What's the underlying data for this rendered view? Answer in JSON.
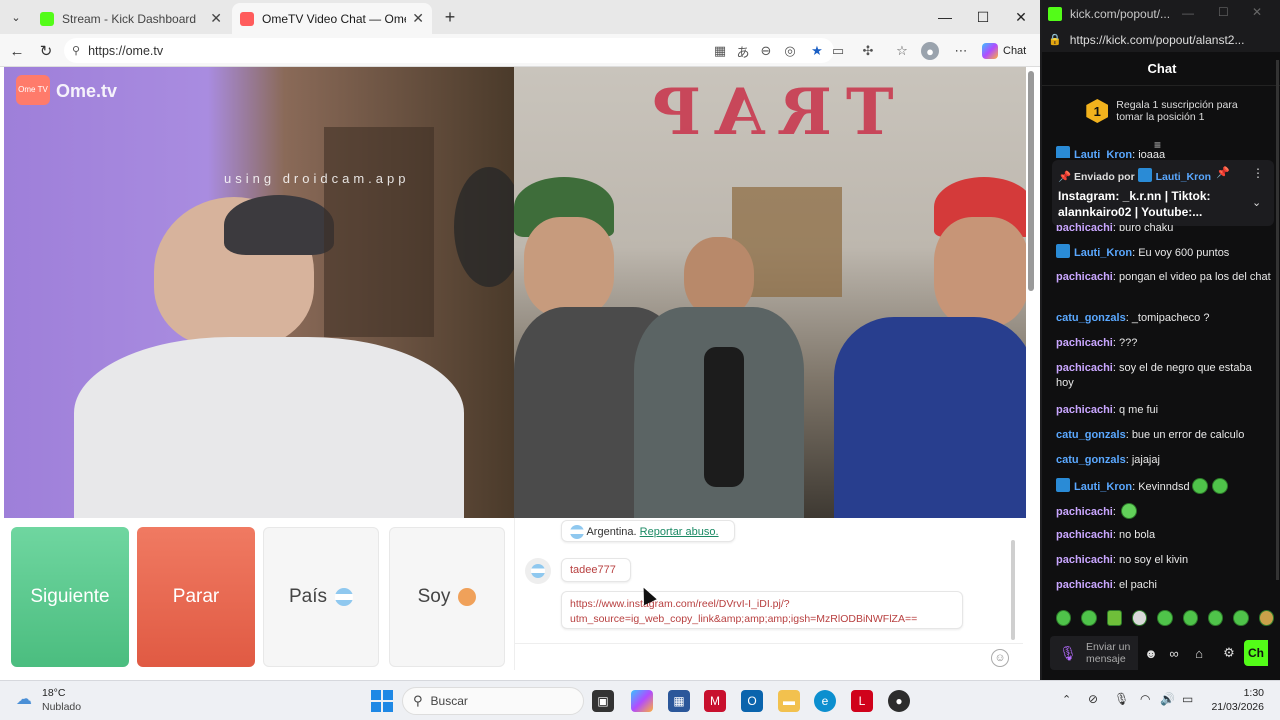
{
  "browser": {
    "tabs": [
      {
        "label": "Stream - Kick Dashboard",
        "active": false,
        "favicon_color": "#53fc18"
      },
      {
        "label": "OmeTV Video Chat — Omegl",
        "active": true,
        "favicon_color": "#ff5c5c"
      }
    ],
    "url": "https://ome.tv",
    "copilot_label": "Chat"
  },
  "ometv": {
    "logo_badge": "Ome TV",
    "logo_text": "Ome.tv",
    "watermark": "using droidcam.app",
    "wall_text": "TRAP",
    "buttons": {
      "next": "Siguiente",
      "stop": "Parar",
      "country": "País",
      "gender": "Soy"
    },
    "chat": {
      "system_country": "Argentina.",
      "report_link": "Reportar abuso.",
      "username": "tadee777",
      "link_line1": "https://www.instagram.com/reel/DVrvI-I_iDI.pj/?",
      "link_line2": "utm_source=ig_web_copy_link&amp;amp;amp;igsh=MzRlODBiNWFlZA=="
    }
  },
  "kick": {
    "window_title": "kick.com/popout/...",
    "url": "https://kick.com/popout/alanst2...",
    "chat_header": "Chat",
    "gift_badge": "1",
    "gift_text_1": "Regala 1 suscripción para",
    "gift_text_2": "tomar la posición 1",
    "partial_top": {
      "user": "Lauti_Kron",
      "text": "joaaa"
    },
    "pinned": {
      "sent_by_label": "Enviado por",
      "user": "Lauti_Kron",
      "text": "Instagram: _k.r.nn | Tiktok: alannkairo02 | Youtube:..."
    },
    "partial_under_pinned": {
      "user": "pachicachi",
      "text": "puro chaku"
    },
    "messages": [
      {
        "user": "Lauti_Kron",
        "text": "Eu voy 600 puntos",
        "color": "#5aa8ff",
        "badge": true
      },
      {
        "user": "pachicachi",
        "text": "pongan el video pa los del chat",
        "color": "#c9a6ff",
        "badge": false
      },
      {
        "user": "catu_gonzals",
        "text": "_tomipacheco ?",
        "color": "#5aa8ff",
        "badge": false
      },
      {
        "user": "pachicachi",
        "text": "???",
        "color": "#c9a6ff",
        "badge": false
      },
      {
        "user": "pachicachi",
        "text": "soy el de negro que estaba hoy",
        "color": "#c9a6ff",
        "badge": false
      },
      {
        "user": "pachicachi",
        "text": "q me fui",
        "color": "#c9a6ff",
        "badge": false
      },
      {
        "user": "catu_gonzals",
        "text": "bue un error de calculo",
        "color": "#5aa8ff",
        "badge": false
      },
      {
        "user": "catu_gonzals",
        "text": "jajajaj",
        "color": "#5aa8ff",
        "badge": false
      },
      {
        "user": "Lauti_Kron",
        "text": "Kevinndsd",
        "color": "#5aa8ff",
        "badge": true
      },
      {
        "user": "pachicachi",
        "text": "",
        "color": "#c9a6ff",
        "badge": false
      },
      {
        "user": "pachicachi",
        "text": "no bola",
        "color": "#c9a6ff",
        "badge": false
      },
      {
        "user": "pachicachi",
        "text": "no soy el kivin",
        "color": "#c9a6ff",
        "badge": false
      },
      {
        "user": "pachicachi",
        "text": "el pachi",
        "color": "#c9a6ff",
        "badge": false
      }
    ],
    "input_placeholder": "Enviar un mensaje",
    "send_label": "Ch"
  },
  "taskbar": {
    "weather_temp": "18°C",
    "weather_desc": "Nublado",
    "search_placeholder": "Buscar",
    "time": "1:30",
    "date": "21/03/2026"
  }
}
